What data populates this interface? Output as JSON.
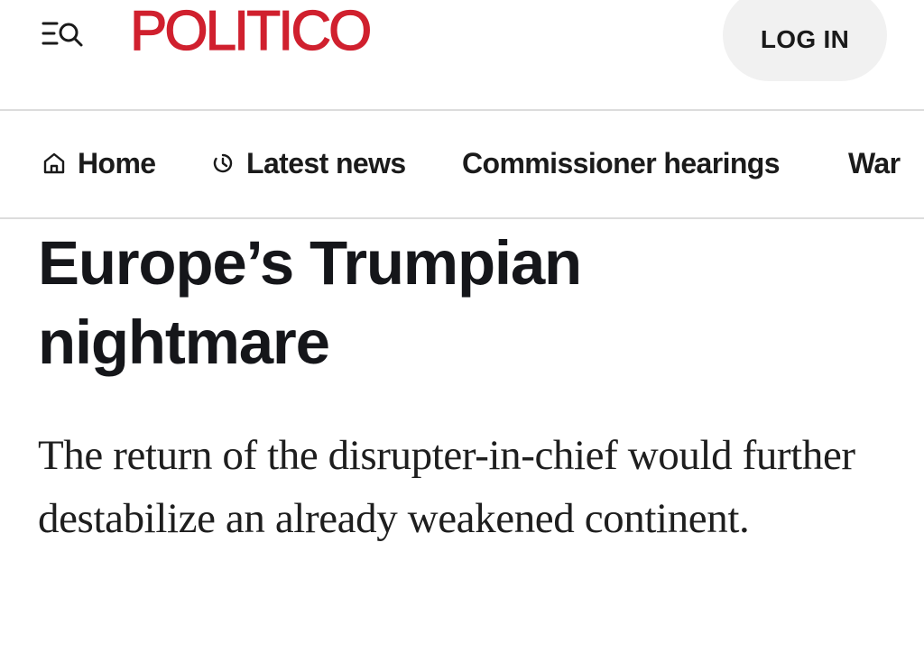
{
  "header": {
    "logo_text": "POLITICO",
    "login_label": "LOG IN",
    "menu_icon": "menu-search-icon",
    "brand_color": "#d0202e"
  },
  "nav": {
    "items": [
      {
        "label": "Home",
        "icon": "home-icon"
      },
      {
        "label": "Latest news",
        "icon": "clock-icon"
      },
      {
        "label": "Commissioner hearings"
      },
      {
        "label": "War"
      }
    ]
  },
  "article": {
    "headline": "Europe’s Trumpian nightmare",
    "dek": "The return of the disrupter-in-chief would further destabilize an already weakened continent."
  }
}
